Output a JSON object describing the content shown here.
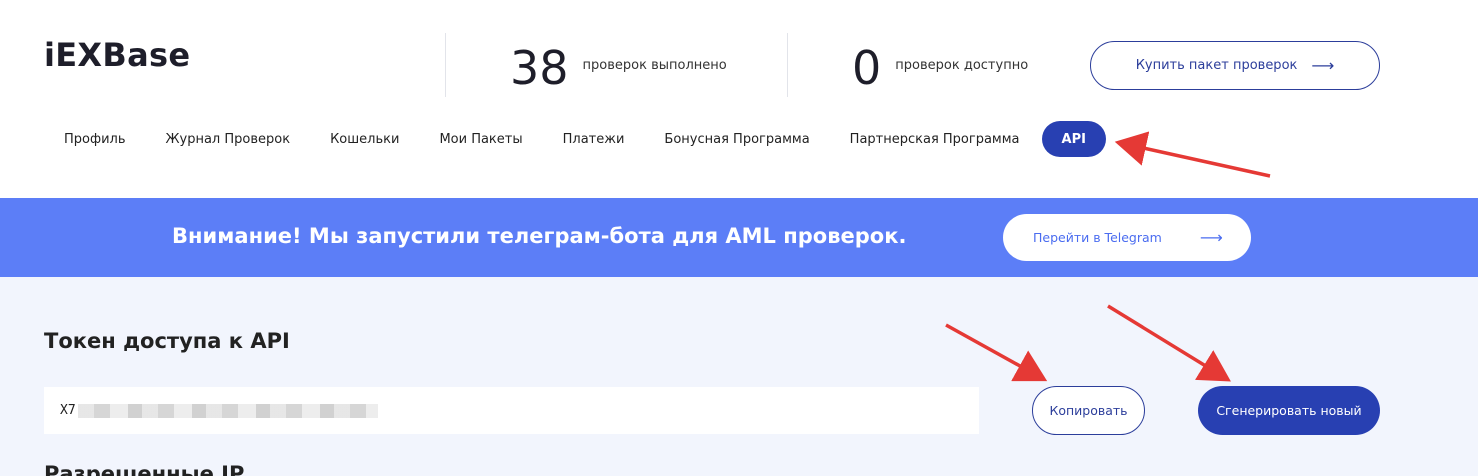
{
  "header": {
    "brand": "iEXBase",
    "stats": [
      {
        "value": "38",
        "label": "проверок выполнено"
      },
      {
        "value": "0",
        "label": "проверок доступно"
      }
    ],
    "buy_button": {
      "label": "Купить пакет проверок",
      "arrow": "⟶"
    }
  },
  "nav": {
    "items": [
      "Профиль",
      "Журнал Проверок",
      "Кошельки",
      "Мои Пакеты",
      "Платежи",
      "Бонусная Программа",
      "Партнерская Программа",
      "API"
    ],
    "active": "API"
  },
  "banner": {
    "text": "Внимание! Мы запустили телеграм-бота для AML проверок.",
    "button_label": "Перейти в Telegram",
    "arrow": "⟶"
  },
  "api": {
    "title": "Токен доступа к API",
    "token_visible": "X7",
    "copy_label": "Копировать",
    "generate_label": "Сгенерировать новый",
    "next_title": "Разрешенные IP"
  },
  "colors": {
    "accent": "#2840b2",
    "banner": "#5c7ef7",
    "page_bg": "#f2f5fd",
    "annotation": "#e53935"
  }
}
